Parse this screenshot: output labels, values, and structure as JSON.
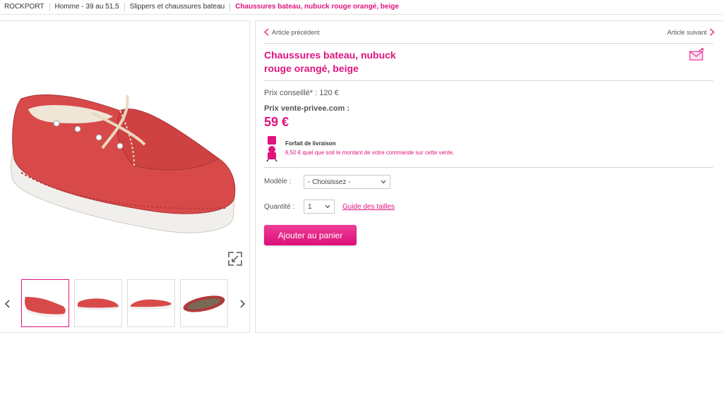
{
  "breadcrumb": {
    "brand": "ROCKPORT",
    "category": "Homme - 39 au 51,5",
    "subcategory": "Slippers et chaussures bateau",
    "current": "Chaussures bateau, nubuck rouge orangé, beige"
  },
  "product": {
    "prev_label": "Article précédent",
    "next_label": "Article suivant",
    "title_line1": "Chaussures bateau, nubuck",
    "title_line2": "rouge orangé, beige",
    "msrp": "Prix conseillé* : 120 €",
    "sale_label": "Prix vente-privee.com :",
    "sale_price": "59 €",
    "delivery_title": "Forfait de livraison",
    "delivery_text": "6,50 € quel que soit le montant de votre commande sur cette vente.",
    "model_label": "Modèle :",
    "model_value": "- Choisissez -",
    "quantity_label": "Quantité :",
    "quantity_value": "1",
    "size_guide": "Guide des tailles",
    "add_to_cart": "Ajouter au panier"
  },
  "gallery": {
    "thumbnails": [
      "side-view",
      "side-view-flat",
      "other-side-view",
      "sole-view"
    ],
    "active_thumbnail": 0
  },
  "icons": {
    "prev": "chevron-left-icon",
    "next": "chevron-right-icon",
    "share": "envelope-icon",
    "zoom": "expand-icon",
    "delivery": "delivery-mascot-icon"
  },
  "colors": {
    "accent": "#e0137f",
    "text": "#444444",
    "border": "#e2e2e2",
    "shoe": "#d84a4a"
  }
}
